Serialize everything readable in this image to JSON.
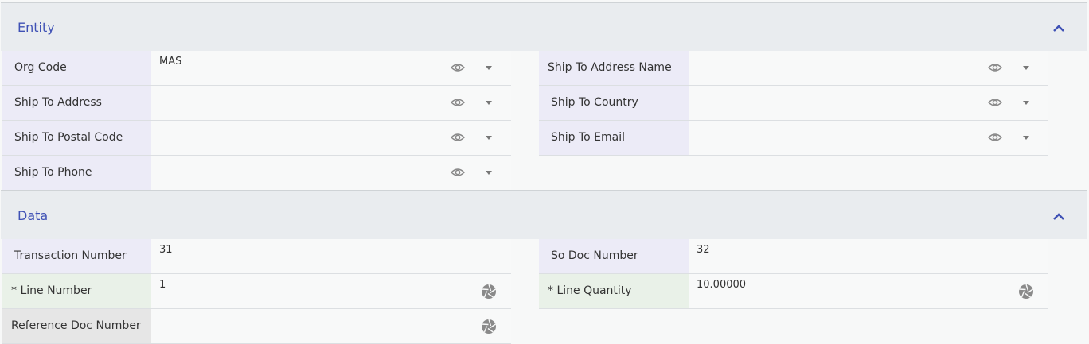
{
  "sections": {
    "entity": {
      "title": "Entity",
      "fields": {
        "org_code": {
          "label": "Org Code",
          "value": "MAS"
        },
        "ship_to_address_name": {
          "label": "Ship To Address Name",
          "value": ""
        },
        "ship_to_address": {
          "label": "Ship To Address",
          "value": ""
        },
        "ship_to_country": {
          "label": "Ship To Country",
          "value": ""
        },
        "ship_to_postal_code": {
          "label": "Ship To Postal Code",
          "value": ""
        },
        "ship_to_email": {
          "label": "Ship To Email",
          "value": ""
        },
        "ship_to_phone": {
          "label": "Ship To Phone",
          "value": ""
        }
      }
    },
    "data": {
      "title": "Data",
      "fields": {
        "transaction_number": {
          "label": "Transaction Number",
          "value": "31"
        },
        "so_doc_number": {
          "label": "So Doc Number",
          "value": "32"
        },
        "line_number": {
          "label": "* Line Number",
          "value": "1"
        },
        "line_quantity": {
          "label": "* Line Quantity",
          "value": "10.00000"
        },
        "reference_doc_number": {
          "label": "Reference Doc Number",
          "value": ""
        }
      }
    }
  },
  "icons": {
    "collapse": "chevron-up-icon",
    "visibility": "eye-icon",
    "dropdown": "caret-down-icon",
    "action": "aperture-icon"
  },
  "colors": {
    "accent": "#3f51b5",
    "header_bg": "#e9ecef",
    "label_purple": "#ecebf7",
    "label_green": "#e9f1e8",
    "label_grey": "#e6e6e6"
  }
}
